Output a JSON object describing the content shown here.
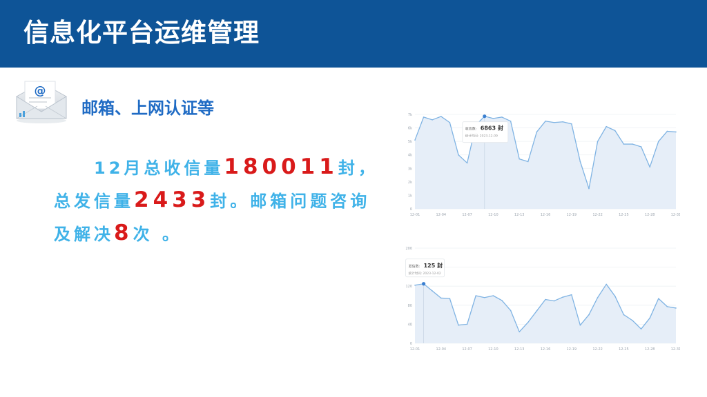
{
  "header": {
    "title": "信息化平台运维管理"
  },
  "section": {
    "icon": "mail-envelope-icon",
    "title": "邮箱、上网认证等"
  },
  "summary": {
    "line1_prefix": "12月总收信量",
    "received_count": "180011",
    "line1_suffix": "封，",
    "line2_prefix": "总发信量",
    "sent_count": "2433",
    "line2_suffix": "封。邮箱问题咨询",
    "line3_prefix": "及解决",
    "issue_count": "8",
    "line3_suffix": "次 。"
  },
  "colors": {
    "header_bg": "#0e5497",
    "accent_text": "#3fb2e8",
    "highlight_number": "#d91a1a",
    "section_title": "#1f6bc4",
    "chart_line": "#7fb3e3",
    "chart_fill": "#e6eef8"
  },
  "chart_data": [
    {
      "type": "area",
      "title": "",
      "x": [
        "12-01",
        "12-02",
        "12-03",
        "12-04",
        "12-05",
        "12-06",
        "12-07",
        "12-08",
        "12-09",
        "12-10",
        "12-11",
        "12-12",
        "12-13",
        "12-14",
        "12-15",
        "12-16",
        "12-17",
        "12-18",
        "12-19",
        "12-20",
        "12-21",
        "12-22",
        "12-23",
        "12-24",
        "12-25",
        "12-26",
        "12-27",
        "12-28",
        "12-29",
        "12-30",
        "12-31"
      ],
      "x_tick_labels": [
        "12-01",
        "12-04",
        "12-07",
        "12-10",
        "12-13",
        "12-16",
        "12-19",
        "12-22",
        "12-25",
        "12-28",
        "12-31"
      ],
      "y_tick_labels": [
        "0",
        "1k",
        "2k",
        "3k",
        "4k",
        "5k",
        "6k",
        "7k"
      ],
      "ylim": [
        0,
        7000
      ],
      "series": [
        {
          "values": [
            5100,
            6800,
            6600,
            6850,
            6400,
            4000,
            3400,
            6200,
            6863,
            6700,
            6800,
            6500,
            3700,
            3500,
            5700,
            6500,
            6400,
            6450,
            6300,
            3500,
            1500,
            5000,
            6100,
            5800,
            4800,
            4800,
            4600,
            3100,
            5000,
            5750,
            5700
          ]
        }
      ],
      "tooltip": {
        "label": "收信数:",
        "value": "6863 封",
        "sub_label": "统计时间:",
        "date": "2023-12-09",
        "index": 8
      }
    },
    {
      "type": "area",
      "title": "",
      "x": [
        "12-01",
        "12-02",
        "12-03",
        "12-04",
        "12-05",
        "12-06",
        "12-07",
        "12-08",
        "12-09",
        "12-10",
        "12-11",
        "12-12",
        "12-13",
        "12-14",
        "12-15",
        "12-16",
        "12-17",
        "12-18",
        "12-19",
        "12-20",
        "12-21",
        "12-22",
        "12-23",
        "12-24",
        "12-25",
        "12-26",
        "12-27",
        "12-28",
        "12-29",
        "12-30",
        "12-31"
      ],
      "x_tick_labels": [
        "12-01",
        "12-04",
        "12-07",
        "12-10",
        "12-13",
        "12-16",
        "12-19",
        "12-22",
        "12-25",
        "12-28",
        "12-31"
      ],
      "y_tick_labels": [
        "0",
        "40",
        "80",
        "120",
        "160",
        "200"
      ],
      "ylim": [
        0,
        200
      ],
      "series": [
        {
          "values": [
            122,
            125,
            110,
            95,
            94,
            38,
            40,
            100,
            96,
            100,
            90,
            69,
            24,
            44,
            68,
            92,
            89,
            97,
            102,
            38,
            60,
            96,
            124,
            99,
            60,
            48,
            30,
            53,
            94,
            77,
            74
          ]
        }
      ],
      "tooltip": {
        "label": "发信数:",
        "value": "125 封",
        "sub_label": "统计时间:",
        "date": "2023-12-02",
        "index": 1
      }
    }
  ]
}
